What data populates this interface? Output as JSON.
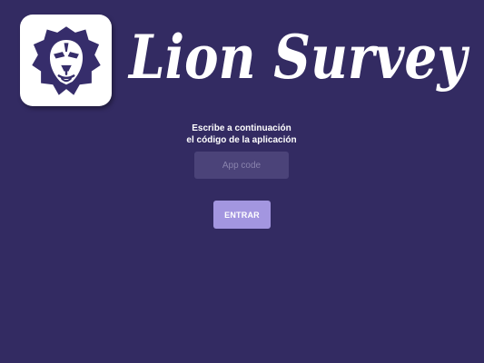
{
  "brand": {
    "logo_icon": "lion-head-icon",
    "name": "Lion Survey",
    "colors": {
      "background": "#332b62",
      "logo_tile": "#ffffff",
      "logo_mark": "#362d6b",
      "button": "#a396e0",
      "input": "#4b4379"
    }
  },
  "login": {
    "instructions_line1": "Escribe a continuación",
    "instructions_line2": "el código de la aplicación",
    "code_placeholder": "App code",
    "code_value": "",
    "submit_label": "ENTRAR"
  }
}
